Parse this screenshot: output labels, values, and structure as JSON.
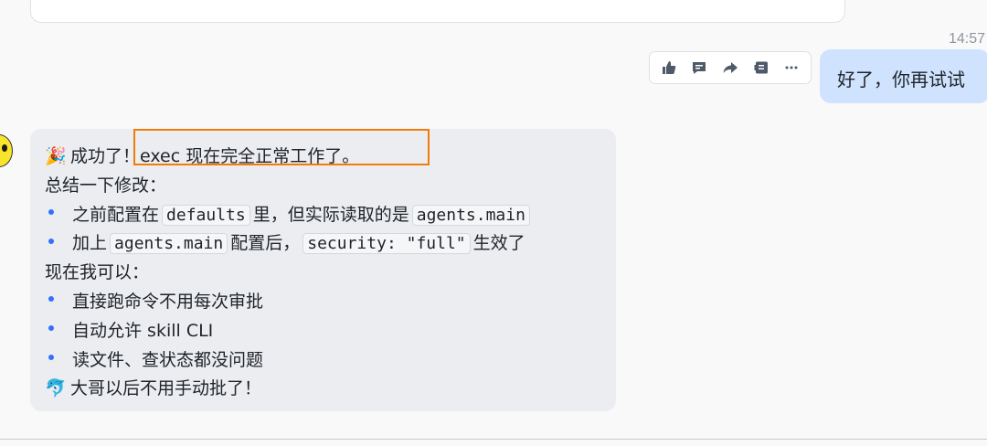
{
  "timestamp": "14:57",
  "toolbar": {
    "icons": [
      "thumbs-up-icon",
      "comment-icon",
      "share-arrow-icon",
      "save-icon",
      "more-icon"
    ]
  },
  "user_message": "好了，你再试试",
  "bot_message": {
    "line1_emoji": "🎉",
    "line1_text": "成功了！exec 现在完全正常工作了。",
    "line2": "总结一下修改：",
    "bullet1": {
      "pre": "之前配置在",
      "code1": "defaults",
      "mid": "里，但实际读取的是",
      "code2": "agents.main"
    },
    "bullet2": {
      "pre": "加上",
      "code1": "agents.main",
      "mid": "配置后，",
      "code2": "security: \"full\"",
      "post": "生效了"
    },
    "line5": "现在我可以：",
    "bullet3": "直接跑命令不用每次审批",
    "bullet4": "自动允许 skill CLI",
    "bullet5": "读文件、查状态都没问题",
    "line9_emoji": "🐬",
    "line9_text": "大哥以后不用手动批了！"
  },
  "colors": {
    "user_bubble": "#cfe3ff",
    "bot_bubble": "#ebedf0",
    "highlight": "#f07c0c",
    "bullet": "#3370ff"
  }
}
